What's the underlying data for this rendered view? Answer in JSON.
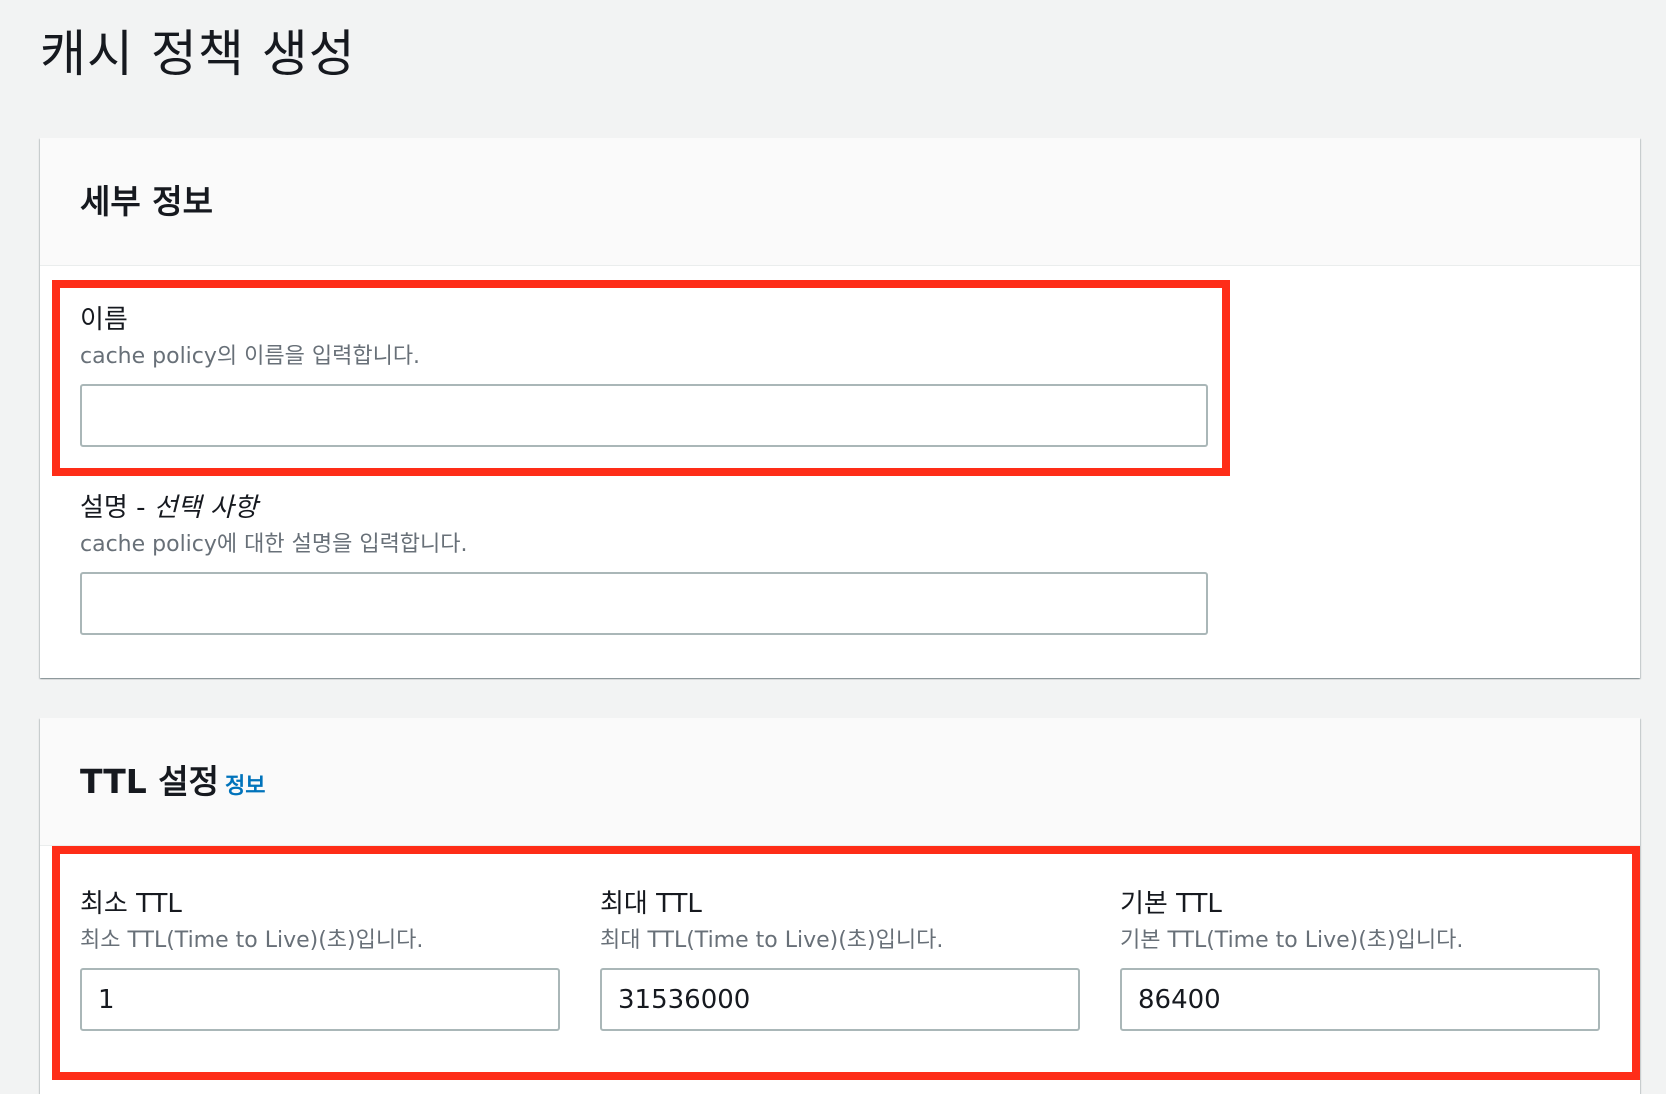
{
  "page": {
    "title": "캐시 정책 생성"
  },
  "details": {
    "title": "세부 정보",
    "name_field": {
      "label": "이름",
      "description": "cache policy의 이름을 입력합니다.",
      "value": ""
    },
    "description_field": {
      "label": "설명 - ",
      "optional": "선택 사항",
      "description": "cache policy에 대한 설명을 입력합니다.",
      "value": ""
    }
  },
  "ttl": {
    "title": "TTL 설정",
    "info_link": "정보",
    "min_ttl": {
      "label": "최소 TTL",
      "description": "최소 TTL(Time to Live)(초)입니다.",
      "value": "1"
    },
    "max_ttl": {
      "label": "최대 TTL",
      "description": "최대 TTL(Time to Live)(초)입니다.",
      "value": "31536000"
    },
    "default_ttl": {
      "label": "기본 TTL",
      "description": "기본 TTL(Time to Live)(초)입니다.",
      "value": "86400"
    }
  },
  "colors": {
    "highlight": "#fe2d18",
    "link": "#0073bb",
    "background": "#f2f3f3"
  }
}
